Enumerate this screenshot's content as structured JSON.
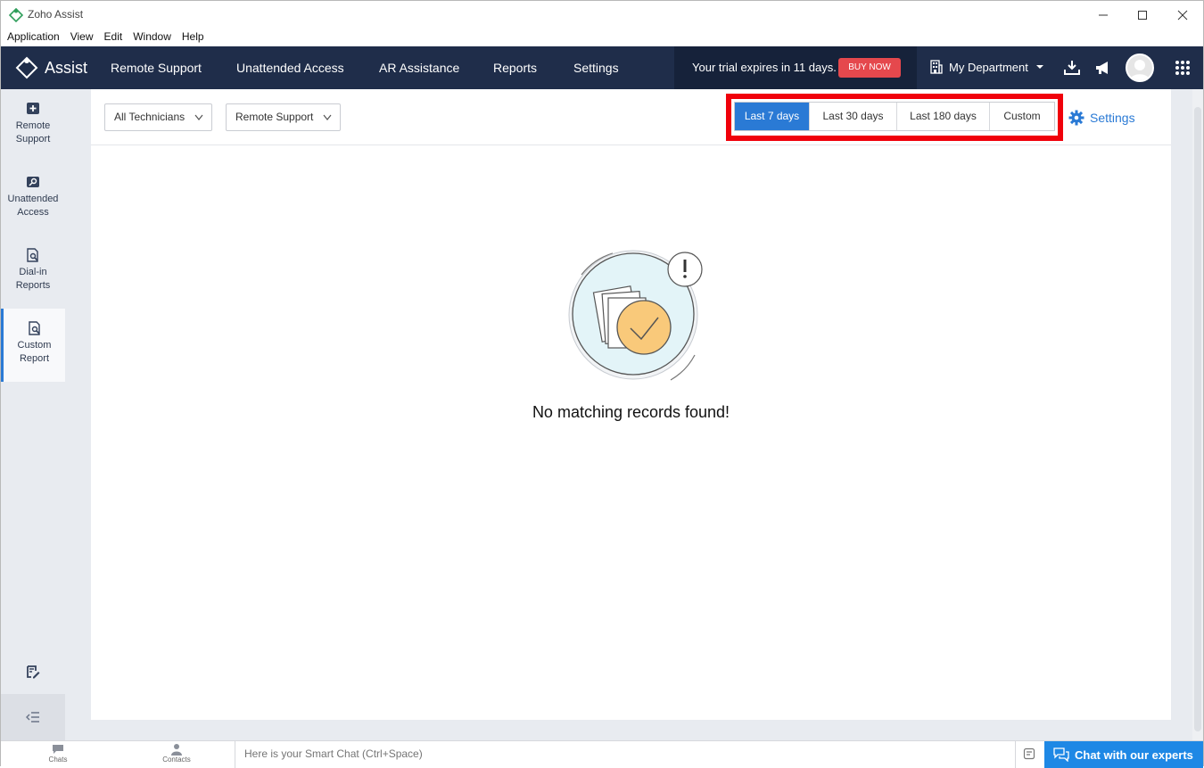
{
  "window": {
    "title": "Zoho Assist",
    "controls": [
      "minimize",
      "maximize",
      "close"
    ]
  },
  "menu": [
    "Application",
    "View",
    "Edit",
    "Window",
    "Help"
  ],
  "topnav": {
    "brand": "Assist",
    "items": [
      "Remote Support",
      "Unattended Access",
      "AR Assistance",
      "Reports",
      "Settings"
    ],
    "trial_text": "Your trial expires in 11 days.",
    "buy_now": "BUY NOW",
    "department": "My Department",
    "icons": [
      "download-icon",
      "megaphone-icon",
      "avatar",
      "apps-grid-icon"
    ]
  },
  "sidebar": {
    "items": [
      {
        "label": "Remote Support",
        "icon": "plus-box-icon"
      },
      {
        "label": "Unattended Access",
        "icon": "key-icon"
      },
      {
        "label": "Dial-in Reports",
        "icon": "report-search-icon"
      },
      {
        "label": "Custom Report",
        "icon": "report-search-icon",
        "active": true
      }
    ],
    "bottom_icons": [
      "edit-note-icon",
      "collapse-icon"
    ]
  },
  "filters": {
    "technician": "All Technicians",
    "session_type": "Remote Support",
    "ranges": [
      "Last 7 days",
      "Last 30 days",
      "Last 180 days",
      "Custom"
    ],
    "selected_range": "Last 7 days",
    "settings": "Settings"
  },
  "empty_state": {
    "message": "No matching records found!"
  },
  "bottombar": {
    "tabs": [
      "Chats",
      "Contacts"
    ],
    "smartchat_placeholder": "Here is your Smart Chat (Ctrl+Space)",
    "expert_button": "Chat with our experts"
  },
  "colors": {
    "nav_bg": "#1f2d4a",
    "accent": "#2a7ad5",
    "buy_now": "#e5484d",
    "highlight": "#f0000a",
    "expert": "#1e88e5"
  }
}
